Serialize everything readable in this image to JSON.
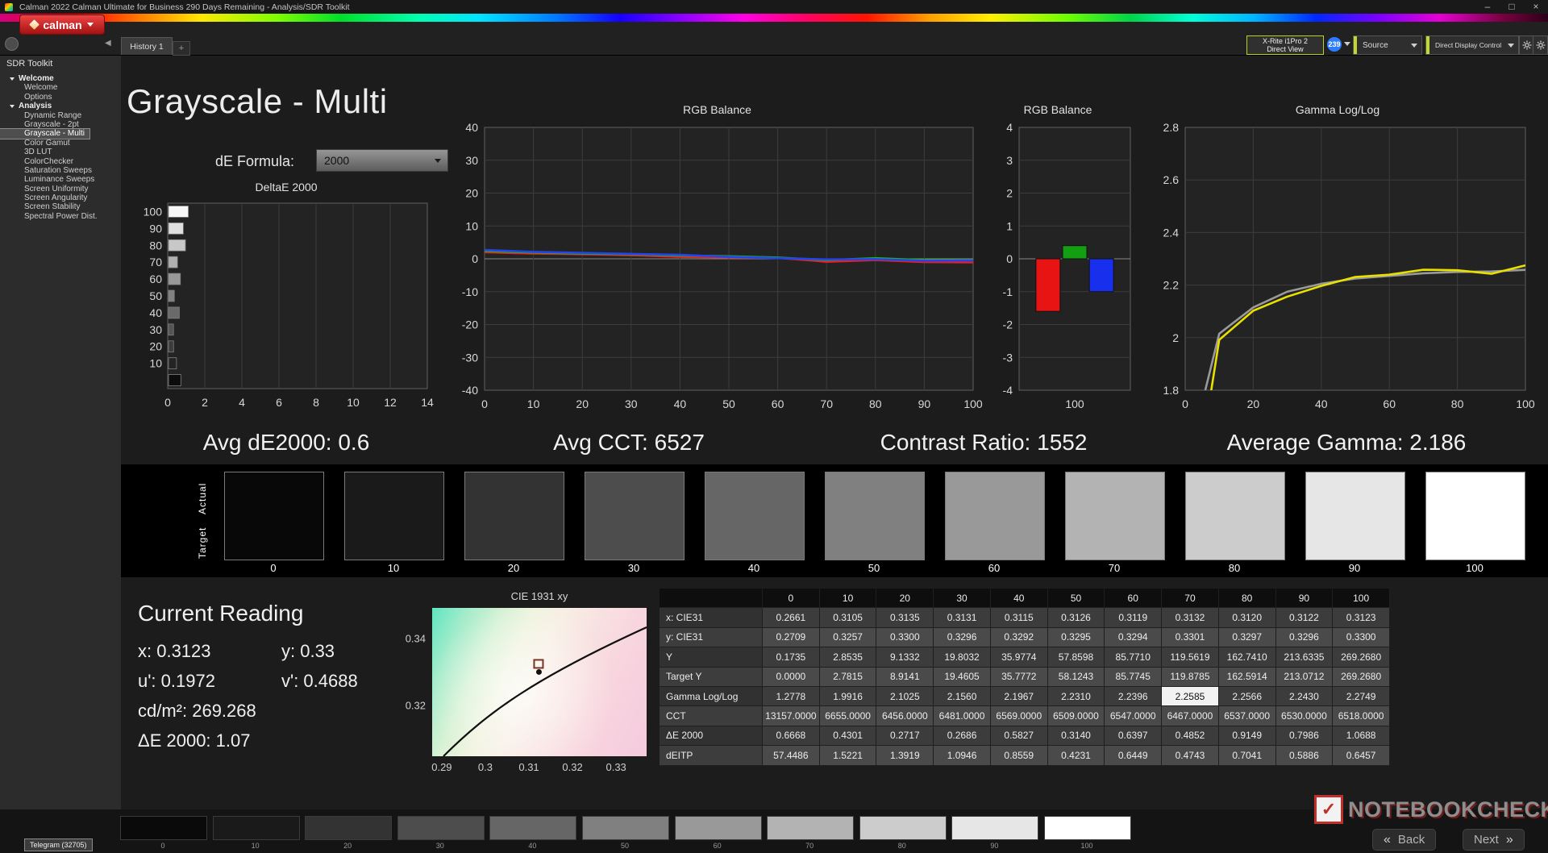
{
  "icons": {
    "minimize": "–",
    "maximize": "□",
    "close": "×",
    "back_chevron": "«",
    "next_chevron": "»",
    "collapse_left": "◀",
    "add_tab": "+"
  },
  "titlebar": {
    "title": "Calman 2022 Calman Ultimate for Business 290 Days Remaining  - Analysis/SDR Toolkit"
  },
  "toolbar": {
    "logo_text": "calman",
    "meter_line1": "X-Rite i1Pro 2",
    "meter_line2": "Direct View",
    "badge": "239",
    "source": "Source",
    "display_control": "Direct Display Control"
  },
  "tabs": {
    "history": "History 1"
  },
  "sidebar": {
    "title": "SDR Toolkit",
    "tree": [
      {
        "label": "Welcome",
        "level": 0
      },
      {
        "label": "Welcome",
        "level": 1
      },
      {
        "label": "Options",
        "level": 1
      },
      {
        "label": "Analysis",
        "level": 0
      },
      {
        "label": "Dynamic Range",
        "level": 1
      },
      {
        "label": "Grayscale - 2pt",
        "level": 1
      },
      {
        "label": "Grayscale - Multi",
        "level": 1,
        "selected": true
      },
      {
        "label": "Color Gamut",
        "level": 1
      },
      {
        "label": "3D LUT",
        "level": 1
      },
      {
        "label": "ColorChecker",
        "level": 1
      },
      {
        "label": "Saturation Sweeps",
        "level": 1
      },
      {
        "label": "Luminance Sweeps",
        "level": 1
      },
      {
        "label": "Screen Uniformity",
        "level": 1
      },
      {
        "label": "Screen Angularity",
        "level": 1
      },
      {
        "label": "Screen Stability",
        "level": 1
      },
      {
        "label": "Spectral Power Dist.",
        "level": 1
      }
    ]
  },
  "page": {
    "title": "Grayscale - Multi",
    "de_formula_label": "dE Formula:",
    "de_formula_value": "2000"
  },
  "stats": {
    "avg_de": "Avg dE2000: 0.6",
    "avg_cct": "Avg CCT: 6527",
    "contrast": "Contrast Ratio: 1552",
    "avg_gamma": "Average Gamma: 2.186"
  },
  "swatches": {
    "actual_label": "Actual",
    "target_label": "Target",
    "levels": [
      "0",
      "10",
      "20",
      "30",
      "40",
      "50",
      "60",
      "70",
      "80",
      "90",
      "100"
    ]
  },
  "current_reading": {
    "title": "Current Reading",
    "lines": [
      [
        "x: 0.3123",
        "y: 0.33"
      ],
      [
        "u': 0.1972",
        "v': 0.4688"
      ],
      [
        "cd/m²: 269.268"
      ],
      [
        "ΔE 2000: 1.07"
      ]
    ]
  },
  "table": {
    "columns": [
      "",
      "0",
      "10",
      "20",
      "30",
      "40",
      "50",
      "60",
      "70",
      "80",
      "90",
      "100"
    ],
    "rows": [
      {
        "label": "x: CIE31",
        "values": [
          "0.2661",
          "0.3105",
          "0.3135",
          "0.3131",
          "0.3115",
          "0.3126",
          "0.3119",
          "0.3132",
          "0.3120",
          "0.3122",
          "0.3123"
        ]
      },
      {
        "label": "y: CIE31",
        "values": [
          "0.2709",
          "0.3257",
          "0.3300",
          "0.3296",
          "0.3292",
          "0.3295",
          "0.3294",
          "0.3301",
          "0.3297",
          "0.3296",
          "0.3300"
        ]
      },
      {
        "label": "Y",
        "values": [
          "0.1735",
          "2.8535",
          "9.1332",
          "19.8032",
          "35.9774",
          "57.8598",
          "85.7710",
          "119.5619",
          "162.7410",
          "213.6335",
          "269.2680"
        ]
      },
      {
        "label": "Target Y",
        "values": [
          "0.0000",
          "2.7815",
          "8.9141",
          "19.4605",
          "35.7772",
          "58.1243",
          "85.7745",
          "119.8785",
          "162.5914",
          "213.0712",
          "269.2680"
        ]
      },
      {
        "label": "Gamma Log/Log",
        "values": [
          "1.2778",
          "1.9916",
          "2.1025",
          "2.1560",
          "2.1967",
          "2.2310",
          "2.2396",
          "2.2585",
          "2.2566",
          "2.2430",
          "2.2749"
        ]
      },
      {
        "label": "CCT",
        "values": [
          "13157.0000",
          "6655.0000",
          "6456.0000",
          "6481.0000",
          "6569.0000",
          "6509.0000",
          "6547.0000",
          "6467.0000",
          "6537.0000",
          "6530.0000",
          "6518.0000"
        ]
      },
      {
        "label": "ΔE 2000",
        "values": [
          "0.6668",
          "0.4301",
          "0.2717",
          "0.2686",
          "0.5827",
          "0.3140",
          "0.6397",
          "0.4852",
          "0.9149",
          "0.7986",
          "1.0688"
        ]
      },
      {
        "label": "dEITP",
        "values": [
          "57.4486",
          "1.5221",
          "1.3919",
          "1.0946",
          "0.8559",
          "0.4231",
          "0.6449",
          "0.4743",
          "0.7041",
          "0.5886",
          "0.6457"
        ]
      }
    ],
    "highlight": {
      "row": 4,
      "col": 7
    }
  },
  "bottom_strip": {
    "levels": [
      "0",
      "10",
      "20",
      "30",
      "40",
      "50",
      "60",
      "70",
      "80",
      "90",
      "100"
    ]
  },
  "nav": {
    "back": "Back",
    "next": "Next"
  },
  "watermark": {
    "text": "NOTEBOOKCHECK"
  },
  "taskbar": {
    "item": "Telegram (32705)"
  },
  "chart_data": [
    {
      "id": "deltae",
      "type": "bar",
      "title": "DeltaE 2000",
      "categories": [
        100,
        90,
        80,
        70,
        60,
        50,
        40,
        30,
        20,
        10,
        0
      ],
      "values": [
        1.0688,
        0.7986,
        0.9149,
        0.4852,
        0.6397,
        0.314,
        0.5827,
        0.2686,
        0.2717,
        0.4301,
        0.6668
      ],
      "xlim": [
        0,
        14
      ],
      "xticks": [
        0,
        2,
        4,
        6,
        8,
        10,
        12,
        14
      ]
    },
    {
      "id": "rgb_balance_line",
      "type": "line",
      "title": "RGB Balance",
      "x": [
        0,
        10,
        20,
        30,
        40,
        50,
        60,
        70,
        80,
        90,
        100
      ],
      "series": [
        {
          "name": "red",
          "color": "#e81e1e",
          "values": [
            2.0,
            1.6,
            1.4,
            1.1,
            0.6,
            0.4,
            0.3,
            -0.9,
            -0.4,
            -1.0,
            -1.1
          ]
        },
        {
          "name": "green",
          "color": "#1fb41f",
          "values": [
            2.4,
            1.9,
            1.6,
            1.4,
            1.0,
            0.8,
            0.4,
            -0.4,
            0.2,
            -0.4,
            -0.4
          ]
        },
        {
          "name": "blue",
          "color": "#2244ee",
          "values": [
            2.7,
            2.1,
            1.8,
            1.5,
            1.2,
            0.6,
            0.2,
            -0.2,
            -0.1,
            -0.6,
            -0.5
          ]
        }
      ],
      "ylim": [
        -40,
        40
      ],
      "yticks": [
        40,
        30,
        20,
        10,
        0,
        -10,
        -20,
        -30,
        -40
      ],
      "xticks": [
        0,
        10,
        20,
        30,
        40,
        50,
        60,
        70,
        80,
        90,
        100
      ]
    },
    {
      "id": "rgb_balance_bar",
      "type": "bar",
      "title": "RGB Balance",
      "categories": [
        "red",
        "green",
        "blue"
      ],
      "values": [
        -1.6,
        0.4,
        -1.0
      ],
      "colors": [
        "#e81414",
        "#12a012",
        "#1830ee"
      ],
      "ylim": [
        -4,
        4
      ],
      "yticks": [
        4,
        3,
        2,
        1,
        0,
        -1,
        -2,
        -3,
        -4
      ],
      "xticks": [
        100
      ]
    },
    {
      "id": "gamma_loglog",
      "type": "line",
      "title": "Gamma Log/Log",
      "x": [
        4,
        10,
        20,
        30,
        40,
        50,
        60,
        70,
        80,
        90,
        100
      ],
      "series": [
        {
          "name": "target",
          "color": "#9a9a9a",
          "values": [
            1.7,
            2.015,
            2.115,
            2.175,
            2.205,
            2.225,
            2.235,
            2.245,
            2.25,
            2.252,
            2.258
          ]
        },
        {
          "name": "measured",
          "color": "#e8e000",
          "values": [
            1.5,
            1.9916,
            2.1025,
            2.156,
            2.1967,
            2.231,
            2.2396,
            2.2585,
            2.2566,
            2.243,
            2.2749
          ]
        }
      ],
      "ylim": [
        1.8,
        2.8
      ],
      "yticks": [
        2.8,
        2.6,
        2.4,
        2.2,
        2.0,
        1.8
      ],
      "ytick_labels": [
        "2.8",
        "2.6",
        "2.4",
        "2.2",
        "2",
        "1.8"
      ],
      "xticks": [
        0,
        20,
        40,
        60,
        80,
        100
      ]
    },
    {
      "id": "cie1931",
      "type": "scatter",
      "title": "CIE 1931 xy",
      "point": {
        "x": 0.3123,
        "y": 0.33
      },
      "xlim": [
        0.2878,
        0.337
      ],
      "ylim": [
        0.305,
        0.349
      ],
      "xticks": [
        0.29,
        0.3,
        0.31,
        0.32,
        0.33
      ],
      "yticks": [
        0.34,
        0.32
      ]
    }
  ]
}
